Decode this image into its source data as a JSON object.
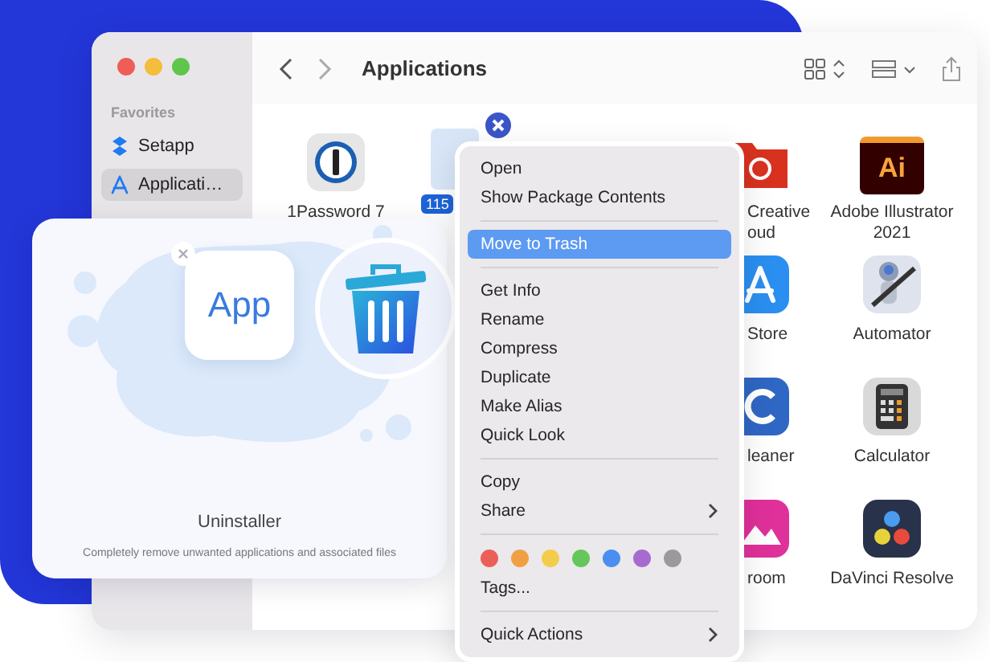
{
  "finder": {
    "title": "Applications",
    "sidebar": {
      "heading": "Favorites",
      "items": [
        {
          "label": "Setapp",
          "selected": false
        },
        {
          "label": "Applicati…",
          "selected": true
        }
      ]
    },
    "column_1": [
      {
        "label": "1Password 7"
      }
    ],
    "column_4": [
      {
        "label": "Creative",
        "label_2": "oud"
      },
      {
        "label": "Store"
      },
      {
        "label": "leaner"
      },
      {
        "label": "room"
      }
    ],
    "column_5": [
      {
        "label": "Adobe Illustrator",
        "label_2": "2021",
        "icon_text": "Ai"
      },
      {
        "label": "Automator"
      },
      {
        "label": "Calculator"
      },
      {
        "label": "DaVinci Resolve"
      }
    ],
    "selected_badge": "115"
  },
  "uninstaller": {
    "tile": "App",
    "title": "Uninstaller",
    "description": "Completely remove unwanted applications and associated files"
  },
  "menu": {
    "sections": [
      [
        {
          "kind": "item",
          "label": "Open",
          "selected": false,
          "submenu": false
        },
        {
          "kind": "item",
          "label": "Show Package Contents",
          "selected": false,
          "submenu": false
        }
      ],
      [
        {
          "kind": "item",
          "label": "Move to Trash",
          "selected": true,
          "submenu": false
        }
      ],
      [
        {
          "kind": "item",
          "label": "Get Info",
          "selected": false,
          "submenu": false
        },
        {
          "kind": "item",
          "label": "Rename",
          "selected": false,
          "submenu": false
        },
        {
          "kind": "item",
          "label": "Compress",
          "selected": false,
          "submenu": false
        },
        {
          "kind": "item",
          "label": "Duplicate",
          "selected": false,
          "submenu": false
        },
        {
          "kind": "item",
          "label": "Make Alias",
          "selected": false,
          "submenu": false
        },
        {
          "kind": "item",
          "label": "Quick Look",
          "selected": false,
          "submenu": false
        }
      ],
      [
        {
          "kind": "item",
          "label": "Copy",
          "selected": false,
          "submenu": false
        },
        {
          "kind": "item",
          "label": "Share",
          "selected": false,
          "submenu": true
        }
      ],
      [
        {
          "kind": "tags",
          "tags": [
            {
              "color": "#ec5f59"
            },
            {
              "color": "#f0a043"
            },
            {
              "color": "#f4cc4b"
            },
            {
              "color": "#66c65b"
            },
            {
              "color": "#4a8ef0"
            },
            {
              "color": "#a76bd0"
            },
            {
              "color": "#9a9a9d"
            }
          ]
        },
        {
          "kind": "item",
          "label": "Tags...",
          "selected": false,
          "submenu": false
        }
      ],
      [
        {
          "kind": "item",
          "label": "Quick Actions",
          "selected": false,
          "submenu": true
        }
      ]
    ]
  }
}
